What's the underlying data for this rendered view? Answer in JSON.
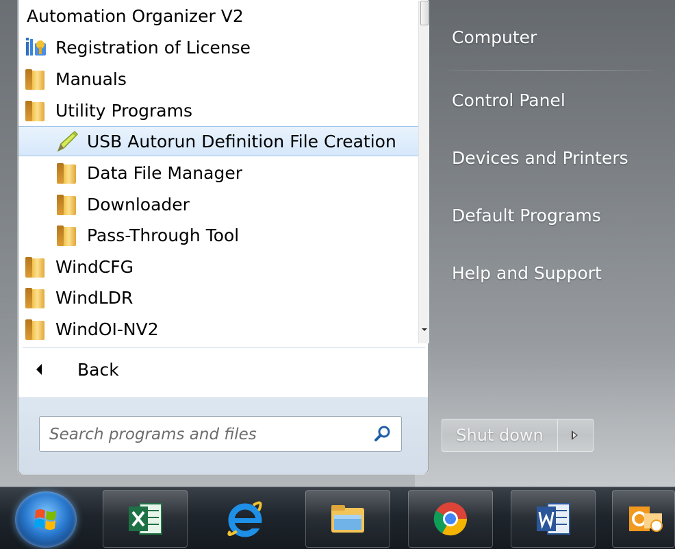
{
  "programs": {
    "items": [
      {
        "label": "Automation Organizer V2",
        "icon": "none",
        "indent": 0
      },
      {
        "label": "Registration of License",
        "icon": "license-icon",
        "indent": 0
      },
      {
        "label": "Manuals",
        "icon": "folder-icon",
        "indent": 0
      },
      {
        "label": "Utility Programs",
        "icon": "folder-icon",
        "indent": 0
      },
      {
        "label": "USB Autorun Definition File Creation",
        "icon": "pencil-icon",
        "indent": 1,
        "selected": true
      },
      {
        "label": "Data File Manager",
        "icon": "folder-icon",
        "indent": 1
      },
      {
        "label": "Downloader",
        "icon": "folder-icon",
        "indent": 1
      },
      {
        "label": "Pass-Through Tool",
        "icon": "folder-icon",
        "indent": 1
      },
      {
        "label": "WindCFG",
        "icon": "folder-icon",
        "indent": 0
      },
      {
        "label": "WindLDR",
        "icon": "folder-icon",
        "indent": 0
      },
      {
        "label": "WindOI-NV2",
        "icon": "folder-icon",
        "indent": 0
      }
    ]
  },
  "back": {
    "label": "Back"
  },
  "search": {
    "placeholder": "Search programs and files"
  },
  "right_pane": {
    "computer": "Computer",
    "control_panel": "Control Panel",
    "devices_printers": "Devices and Printers",
    "default_programs": "Default Programs",
    "help_support": "Help and Support"
  },
  "shutdown": {
    "label": "Shut down"
  },
  "taskbar": {
    "apps": [
      "excel-icon",
      "internet-explorer-icon",
      "file-explorer-icon",
      "chrome-icon",
      "word-icon",
      "outlook-icon"
    ]
  },
  "colors": {
    "selection": "#d6e8fb",
    "menu_glass": "#7d8287",
    "taskbar": "#1f252c"
  }
}
